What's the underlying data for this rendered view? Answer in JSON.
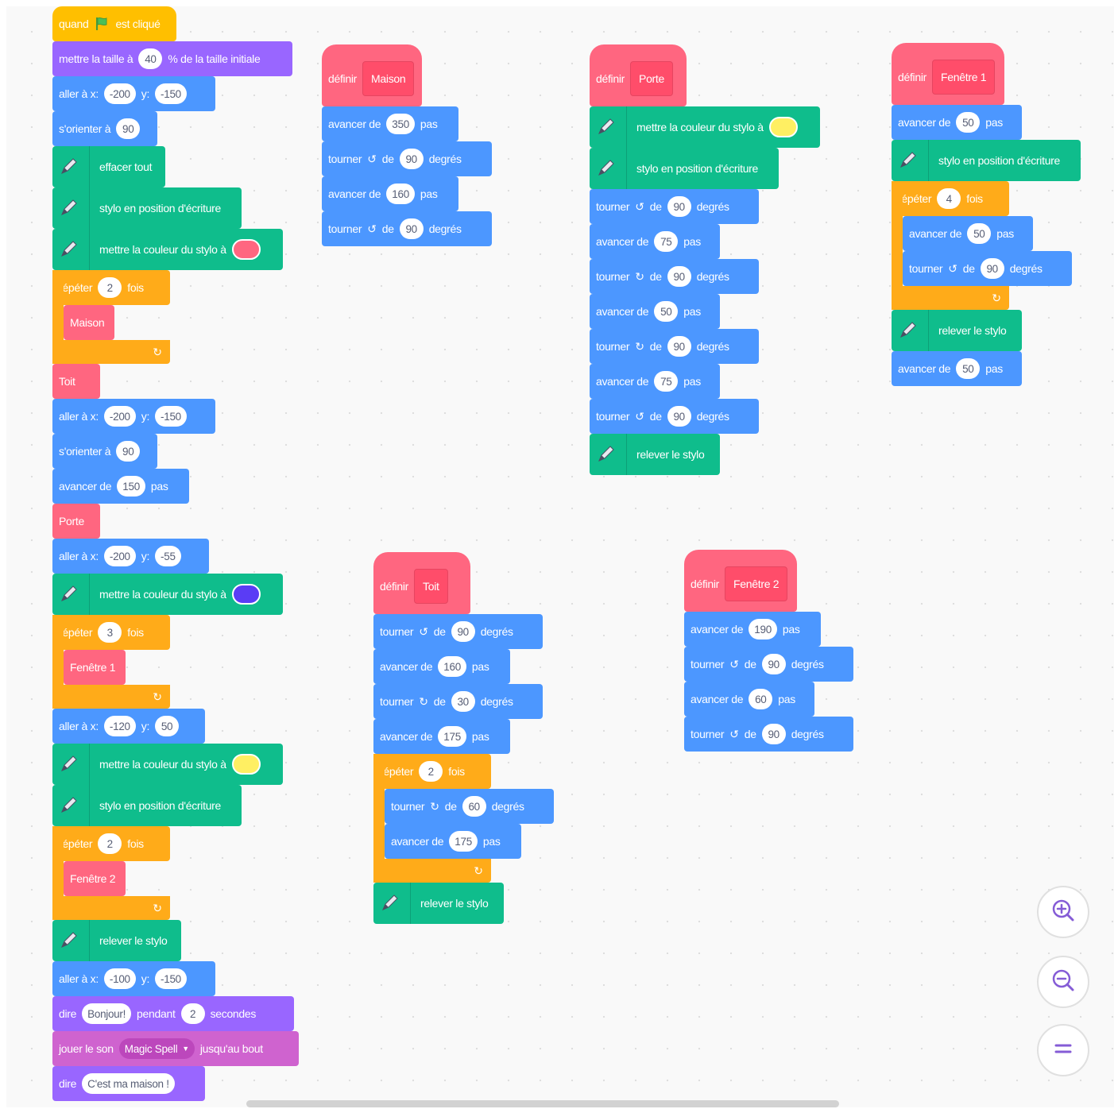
{
  "colors": {
    "motion": "#4c97ff",
    "looks": "#9966ff",
    "sound": "#cf63cf",
    "events": "#ffbf00",
    "pen": "#0fbd8c",
    "control": "#ffab19",
    "myblocks": "#ff6680"
  },
  "main_script": {
    "when_flag": [
      "quand",
      "est cliqué"
    ],
    "set_size": {
      "a": "mettre la taille à",
      "v": "40",
      "b": "% de la taille initiale"
    },
    "goto1": {
      "a": "aller à x:",
      "x": "-200",
      "b": "y:",
      "y": "-150"
    },
    "point1": {
      "a": "s'orienter à",
      "v": "90"
    },
    "clear": "effacer tout",
    "pendown1": "stylo en position d'écriture",
    "setcolor1": {
      "a": "mettre la couleur du stylo à",
      "color": "#ff6680"
    },
    "repeat1": {
      "a": "répéter",
      "v": "2",
      "b": "fois"
    },
    "call_maison": "Maison",
    "call_toit": "Toit",
    "goto2": {
      "a": "aller à x:",
      "x": "-200",
      "b": "y:",
      "y": "-150"
    },
    "point2": {
      "a": "s'orienter à",
      "v": "90"
    },
    "move1": {
      "a": "avancer de",
      "v": "150",
      "b": "pas"
    },
    "call_porte": "Porte",
    "goto3": {
      "a": "aller à x:",
      "x": "-200",
      "b": "y:",
      "y": "-55"
    },
    "setcolor2": {
      "a": "mettre la couleur du stylo à",
      "color": "#5a3cf5"
    },
    "repeat2": {
      "a": "répéter",
      "v": "3",
      "b": "fois"
    },
    "call_f1": "Fenêtre 1",
    "goto4": {
      "a": "aller à x:",
      "x": "-120",
      "b": "y:",
      "y": "50"
    },
    "setcolor3": {
      "a": "mettre la couleur du stylo à",
      "color": "#ffef62"
    },
    "pendown2": "stylo en position d'écriture",
    "repeat3": {
      "a": "répéter",
      "v": "2",
      "b": "fois"
    },
    "call_f2": "Fenêtre 2",
    "penup": "relever le stylo",
    "goto5": {
      "a": "aller à x:",
      "x": "-100",
      "b": "y:",
      "y": "-150"
    },
    "sayfor": {
      "a": "dire",
      "v": "Bonjour!",
      "b": "pendant",
      "s": "2",
      "c": "secondes"
    },
    "playsound": {
      "a": "jouer le son",
      "v": "Magic Spell",
      "b": "jusqu'au bout"
    },
    "say": {
      "a": "dire",
      "v": "C'est ma maison !"
    }
  },
  "def_maison": {
    "define": "définir",
    "name": "Maison",
    "m1": {
      "a": "avancer de",
      "v": "350",
      "b": "pas"
    },
    "t1": {
      "a": "tourner",
      "b": "de",
      "v": "90",
      "c": "degrés"
    },
    "m2": {
      "a": "avancer de",
      "v": "160",
      "b": "pas"
    },
    "t2": {
      "a": "tourner",
      "b": "de",
      "v": "90",
      "c": "degrés"
    }
  },
  "def_porte": {
    "define": "définir",
    "name": "Porte",
    "setcolor": {
      "a": "mettre la couleur du stylo à",
      "color": "#ffef62"
    },
    "pendown": "stylo en position d'écriture",
    "t1": {
      "a": "tourner",
      "b": "de",
      "v": "90",
      "c": "degrés"
    },
    "m1": {
      "a": "avancer de",
      "v": "75",
      "b": "pas"
    },
    "t2": {
      "a": "tourner",
      "b": "de",
      "v": "90",
      "c": "degrés"
    },
    "m2": {
      "a": "avancer de",
      "v": "50",
      "b": "pas"
    },
    "t3": {
      "a": "tourner",
      "b": "de",
      "v": "90",
      "c": "degrés"
    },
    "m3": {
      "a": "avancer de",
      "v": "75",
      "b": "pas"
    },
    "t4": {
      "a": "tourner",
      "b": "de",
      "v": "90",
      "c": "degrés"
    },
    "penup": "relever le stylo"
  },
  "def_f1": {
    "define": "définir",
    "name": "Fenêtre 1",
    "m1": {
      "a": "avancer de",
      "v": "50",
      "b": "pas"
    },
    "pendown": "stylo en position d'écriture",
    "repeat": {
      "a": "répéter",
      "v": "4",
      "b": "fois"
    },
    "m2": {
      "a": "avancer de",
      "v": "50",
      "b": "pas"
    },
    "t1": {
      "a": "tourner",
      "b": "de",
      "v": "90",
      "c": "degrés"
    },
    "penup": "relever le stylo",
    "m3": {
      "a": "avancer de",
      "v": "50",
      "b": "pas"
    }
  },
  "def_toit": {
    "define": "définir",
    "name": "Toit",
    "t1": {
      "a": "tourner",
      "b": "de",
      "v": "90",
      "c": "degrés"
    },
    "m1": {
      "a": "avancer de",
      "v": "160",
      "b": "pas"
    },
    "t2": {
      "a": "tourner",
      "b": "de",
      "v": "30",
      "c": "degrés"
    },
    "m2": {
      "a": "avancer de",
      "v": "175",
      "b": "pas"
    },
    "repeat": {
      "a": "répéter",
      "v": "2",
      "b": "fois"
    },
    "t3": {
      "a": "tourner",
      "b": "de",
      "v": "60",
      "c": "degrés"
    },
    "m3": {
      "a": "avancer de",
      "v": "175",
      "b": "pas"
    },
    "penup": "relever le stylo"
  },
  "def_f2": {
    "define": "définir",
    "name": "Fenêtre 2",
    "m1": {
      "a": "avancer de",
      "v": "190",
      "b": "pas"
    },
    "t1": {
      "a": "tourner",
      "b": "de",
      "v": "90",
      "c": "degrés"
    },
    "m2": {
      "a": "avancer de",
      "v": "60",
      "b": "pas"
    },
    "t2": {
      "a": "tourner",
      "b": "de",
      "v": "90",
      "c": "degrés"
    }
  },
  "zoom": {
    "zoom_in_icon": "zoom-in-icon",
    "zoom_out_icon": "zoom-out-icon",
    "reset_icon": "equals-icon"
  }
}
